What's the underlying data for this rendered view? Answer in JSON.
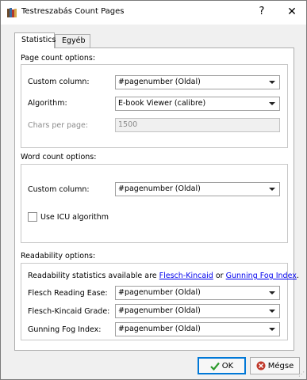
{
  "window": {
    "title": "Testreszabás Count Pages",
    "help_label": "?",
    "close_label": "✕"
  },
  "tabs": [
    {
      "label": "Statistics",
      "active": true
    },
    {
      "label": "Egyéb",
      "active": false
    }
  ],
  "page_count": {
    "section_title": "Page count options:",
    "custom_column_label": "Custom column:",
    "custom_column_value": "#pagenumber (Oldal)",
    "algorithm_label": "Algorithm:",
    "algorithm_value": "E-book Viewer (calibre)",
    "chars_per_page_label": "Chars per page:",
    "chars_per_page_value": "1500"
  },
  "word_count": {
    "section_title": "Word count options:",
    "custom_column_label": "Custom column:",
    "custom_column_value": "#pagenumber (Oldal)",
    "icu_label": "Use ICU algorithm",
    "icu_checked": false
  },
  "readability": {
    "section_title": "Readability options:",
    "intro_prefix": "Readability statistics available are ",
    "link_flesch": "Flesch-Kincaid",
    "intro_or": " or ",
    "link_gunning": "Gunning Fog Index",
    "intro_suffix": ".",
    "flesch_ease_label": "Flesch Reading Ease:",
    "flesch_ease_value": "#pagenumber (Oldal)",
    "flesch_grade_label": "Flesch-Kincaid Grade:",
    "flesch_grade_value": "#pagenumber (Oldal)",
    "gunning_label": "Gunning Fog Index:",
    "gunning_value": "#pagenumber (Oldal)"
  },
  "buttons": {
    "ok_label": "OK",
    "cancel_label": "Mégse"
  },
  "colors": {
    "link": "#0000ee",
    "ok_check": "#2e9a2e",
    "cancel_x": "#c0392b",
    "focus_border": "#0078d7"
  }
}
